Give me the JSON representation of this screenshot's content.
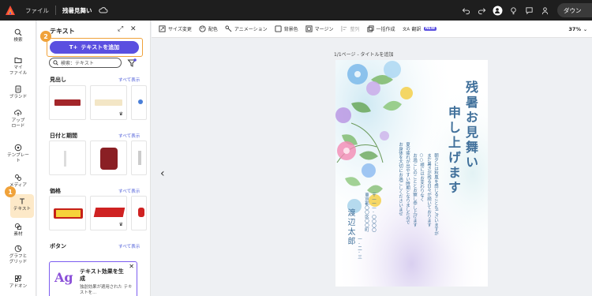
{
  "header": {
    "menu_file": "ファイル",
    "doc_title": "残暑見舞い",
    "download_label": "ダウン"
  },
  "rail": {
    "items": [
      {
        "label": "検索",
        "icon": "search-icon"
      },
      {
        "label": "マイ\nファイル",
        "icon": "folder-icon"
      },
      {
        "label": "ブランド",
        "icon": "brand-icon"
      },
      {
        "label": "アップ\nロード",
        "icon": "upload-icon"
      },
      {
        "label": "テンプレー\nト",
        "icon": "template-icon"
      },
      {
        "label": "メディア",
        "icon": "media-icon"
      },
      {
        "label": "テキスト",
        "icon": "text-icon"
      },
      {
        "label": "素材",
        "icon": "elements-icon"
      },
      {
        "label": "グラフと\nグリッド",
        "icon": "grid-icon"
      },
      {
        "label": "アドオン",
        "icon": "addon-icon"
      }
    ],
    "step_badge": "1"
  },
  "panel": {
    "title": "テキスト",
    "add_button": "テキストを追加",
    "step_badge": "2",
    "search_placeholder": "検索：テキスト",
    "see_all": "すべて表示",
    "sections": {
      "heading": "見出し",
      "datetime": "日付と期間",
      "price": "価格",
      "button": "ボタン"
    },
    "promo": {
      "icon_text": "Ag",
      "title": "テキスト効果を生成",
      "desc": "独創効果が適用された テキストを..."
    }
  },
  "toolbar": {
    "items": [
      "サイズ変更",
      "配色",
      "アニメーション",
      "背景色",
      "マージン",
      "整列",
      "一括作成",
      "翻訳"
    ],
    "new_badge": "NEW",
    "zoom": "37%"
  },
  "canvas": {
    "page_label": "1/1ページ - タイトルを追加",
    "card": {
      "title_col1": "残暑お見舞い",
      "title_col2": "申し上げます",
      "body_cols": [
        "朝夕には秋風を感じることもございますが",
        "まだ暑さが残る日々が続いております",
        "○○様にはお変わりなく",
        "お過ごしのこととお察し申し上げます",
        "夏の疲れが出やすい時期となりましたので",
        "お身体を大切にお過ごしくださいませ"
      ],
      "address_cols": [
        "〒一一一-〇〇〇〇",
        "東京都〇〇区〇〇町",
        "一-二-三"
      ],
      "name": "渡辺太郎"
    }
  },
  "colors": {
    "accent": "#5a4fe0",
    "step_badge": "#f0a23a",
    "card_text": "#3f6f9a"
  }
}
